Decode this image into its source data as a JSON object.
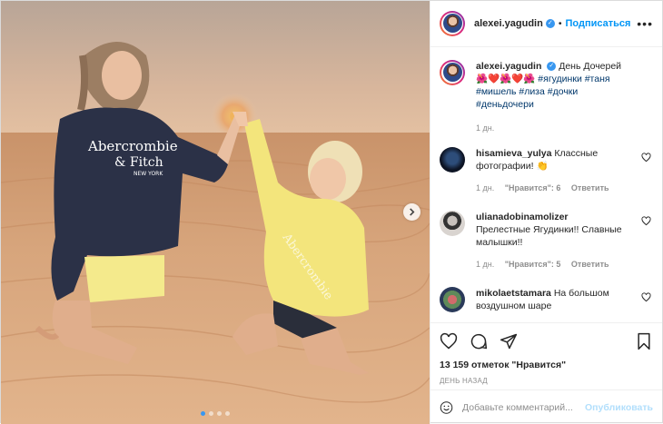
{
  "post": {
    "author": "alexei.yagudin",
    "follow_label": "Подписаться",
    "separator": "•",
    "more_label": "•••"
  },
  "photo": {
    "carousel_count": 4,
    "carousel_active": 0,
    "sweatshirt_text_1": "Abercrombie",
    "sweatshirt_text_2": "& Fitch",
    "sweatshirt_text_3": "NEW YORK"
  },
  "caption": {
    "username": "alexei.yagudin",
    "text": "День Дочерей 🌺❤️🌺❤️🌺",
    "hashtags": "#ягудинки #таня #мишель #лиза #дочки #деньдочери",
    "time": "1 дн."
  },
  "comments": [
    {
      "username": "hisamieva_yulya",
      "text": "Классные фотографии! 👏",
      "time": "1 дн.",
      "likes": "\"Нравится\": 6",
      "reply": "Ответить"
    },
    {
      "username": "ulianadobinamolizer",
      "text": "Прелестные Ягудинки!! Славные малышки!!",
      "time": "1 дн.",
      "likes": "\"Нравится\": 5",
      "reply": "Ответить"
    },
    {
      "username": "mikolaetstamara",
      "text": "На большом воздушном шаре",
      "time": "",
      "likes": "",
      "reply": ""
    }
  ],
  "actions": {
    "likes_text": "13 159 отметок \"Нравится\"",
    "date_text": "День назад"
  },
  "add_comment": {
    "placeholder": "Добавьте комментарий...",
    "publish_label": "Опубликовать"
  },
  "colors": {
    "accent": "#0095f6",
    "publish_disabled": "#b2dffc",
    "muted": "#8e8e8e"
  }
}
